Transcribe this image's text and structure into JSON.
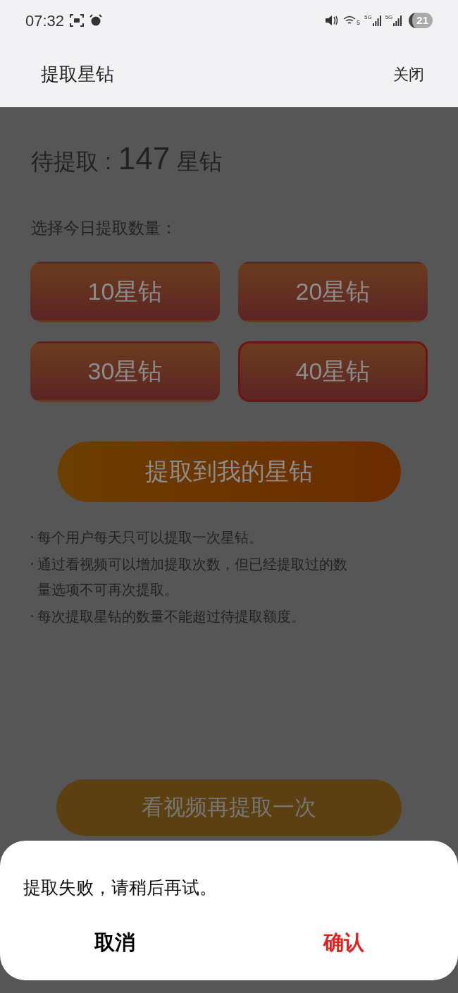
{
  "status_bar": {
    "time": "07:32",
    "wifi_badge": "5",
    "sim_labels": [
      "5G",
      "5G"
    ],
    "battery": "21"
  },
  "header": {
    "title": "提取星钻",
    "close": "关闭"
  },
  "pending": {
    "label": "待提取 :",
    "amount": "147",
    "unit": "星钻"
  },
  "prompt": "选择今日提取数量：",
  "options": [
    {
      "label": "10星钻",
      "selected": false
    },
    {
      "label": "20星钻",
      "selected": false
    },
    {
      "label": "30星钻",
      "selected": false
    },
    {
      "label": "40星钻",
      "selected": true
    }
  ],
  "extract_button": "提取到我的星钻",
  "notes": [
    "每个用户每天只可以提取一次星钻。",
    "通过看视频可以增加提取次数，但已经提取过的数量选项不可再次提取。",
    "每次提取星钻的数量不能超过待提取额度。"
  ],
  "video_button": "看视频再提取一次",
  "dialog": {
    "message": "提取失败，请稍后再试。",
    "buttons": [
      {
        "label": "取消",
        "kind": "cancel"
      },
      {
        "label": "确认",
        "kind": "confirm"
      }
    ]
  }
}
